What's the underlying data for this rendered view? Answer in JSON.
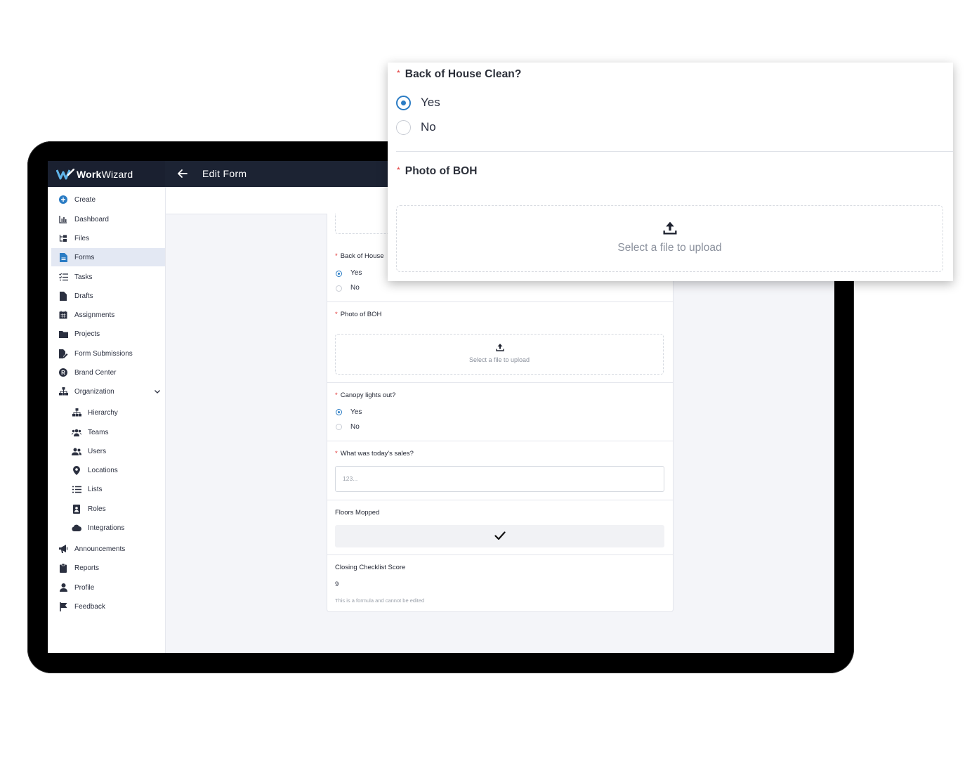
{
  "app": {
    "brand_bold": "Work",
    "brand_rest": "Wizard",
    "page_title": "Edit Form"
  },
  "sidebar": {
    "items": [
      {
        "label": "Create",
        "icon": "plus-circle-icon"
      },
      {
        "label": "Dashboard",
        "icon": "bar-chart-icon"
      },
      {
        "label": "Files",
        "icon": "folder-tree-icon"
      },
      {
        "label": "Forms",
        "icon": "form-file-icon",
        "active": true
      },
      {
        "label": "Tasks",
        "icon": "task-list-icon"
      },
      {
        "label": "Drafts",
        "icon": "file-icon"
      },
      {
        "label": "Assignments",
        "icon": "calendar-icon"
      },
      {
        "label": "Projects",
        "icon": "folder-icon"
      },
      {
        "label": "Form Submissions",
        "icon": "file-edit-icon"
      },
      {
        "label": "Brand Center",
        "icon": "brand-r-icon"
      },
      {
        "label": "Organization",
        "icon": "sitemap-icon",
        "expanded": true
      }
    ],
    "org_items": [
      {
        "label": "Hierarchy",
        "icon": "sitemap-icon"
      },
      {
        "label": "Teams",
        "icon": "users-icon"
      },
      {
        "label": "Users",
        "icon": "user-friends-icon"
      },
      {
        "label": "Locations",
        "icon": "map-pin-icon"
      },
      {
        "label": "Lists",
        "icon": "list-icon"
      },
      {
        "label": "Roles",
        "icon": "id-badge-icon"
      },
      {
        "label": "Integrations",
        "icon": "cloud-icon"
      }
    ],
    "bottom_items": [
      {
        "label": "Announcements",
        "icon": "megaphone-icon"
      },
      {
        "label": "Reports",
        "icon": "clipboard-icon"
      },
      {
        "label": "Profile",
        "icon": "user-icon"
      },
      {
        "label": "Feedback",
        "icon": "flag-icon"
      }
    ]
  },
  "form": {
    "q_back_of_house": "Back of House Clean?",
    "q_back_of_house_truncated": "Back of House",
    "opt_yes": "Yes",
    "opt_no": "No",
    "q_photo": "Photo of BOH",
    "upload_text": "Select a file to upload",
    "q_canopy": "Canopy lights out?",
    "q_sales": "What was today's sales?",
    "sales_placeholder": "123...",
    "q_floors": "Floors Mopped",
    "q_score": "Closing Checklist Score",
    "score_value": "9",
    "score_note": "This is a formula and cannot be edited",
    "required_mark": "*"
  },
  "colors": {
    "topbar": "#1c2333",
    "accent": "#2b7cc4",
    "required": "#e23a3a",
    "active_nav": "#e3e8f3"
  }
}
